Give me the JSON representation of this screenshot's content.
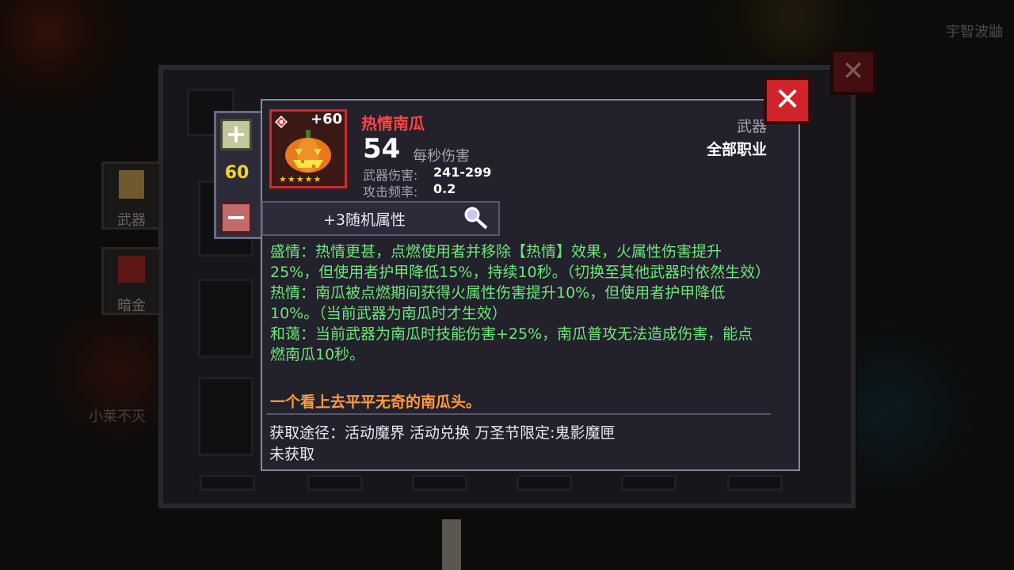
{
  "background": {
    "player_name_top": "宇智波鼬",
    "player_name_left": "小莱不灭",
    "side_tabs": [
      {
        "label": "武器",
        "icon": "weapon-tab-icon"
      },
      {
        "label": "暗金",
        "icon": "dark-gold-tab-icon"
      }
    ],
    "outer_close": "✕"
  },
  "stepper": {
    "plus": "+",
    "quantity": "60",
    "minus": "−"
  },
  "item": {
    "level_badge": "+60",
    "name": "热情南瓜",
    "dps": "54",
    "dps_label": "每秒伤害",
    "damage_label": "武器伤害:",
    "damage_value": "241-299",
    "rate_label": "攻击频率:",
    "rate_value": "0.2",
    "type": "武器",
    "class": "全部职业",
    "stars": "★★★★★",
    "random_attrs": "+3随机属性",
    "description": [
      "盛情：热情更甚，点燃使用者并移除【热情】效果，火属性伤害提升25%，但使用者护甲降低15%，持续10秒。（切换至其他武器时依然生效）",
      "热情：南瓜被点燃期间获得火属性伤害提升10%，但使用者护甲降低10%。（当前武器为南瓜时才生效）",
      "和蔼：当前武器为南瓜时技能伤害+25%，南瓜普攻无法造成伤害，能点燃南瓜10秒。"
    ],
    "flavor": "一个看上去平平无奇的南瓜头。",
    "source": "获取途径：活动魔界 活动兑换 万圣节限定:鬼影魔匣",
    "status": "未获取"
  },
  "close": "✕",
  "colors": {
    "name": "#ff4444",
    "description": "#6ee57a",
    "flavor": "#ff9a40",
    "quantity": "#f2d22e",
    "close": "#d0232a"
  }
}
